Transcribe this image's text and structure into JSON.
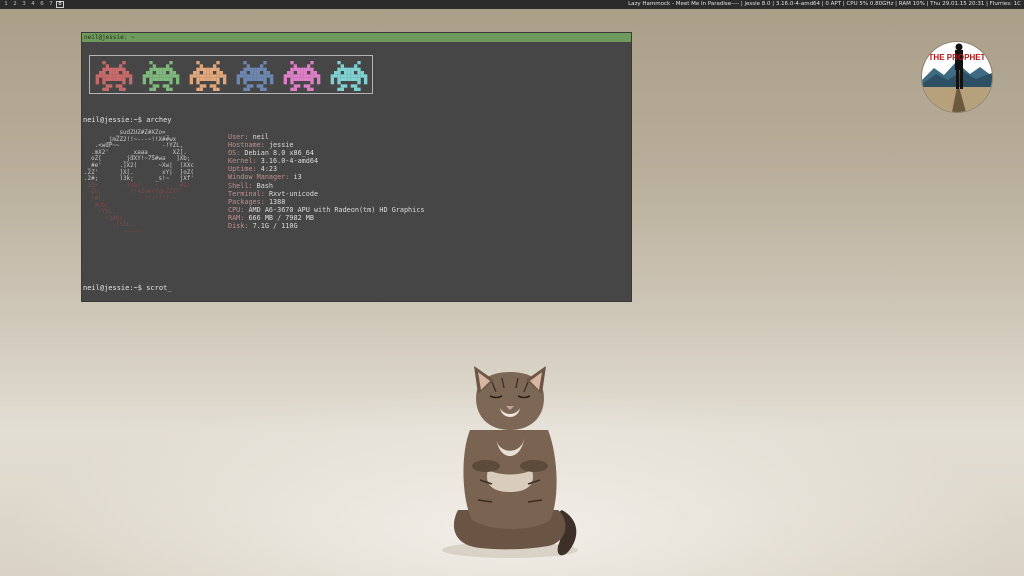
{
  "topbar": {
    "workspaces": [
      "1",
      "2",
      "3",
      "4",
      "6",
      "7",
      "8"
    ],
    "active_workspace": "8",
    "status": "Lazy Hammock - Meet Me In Paradise---- | jessie 8.0 | 3.16.0-4-amd64 | 0 APT | CPU 5% 0.80GHz | RAM 10% | Thu 29.01.15 20:31 | Flurries: 1C"
  },
  "terminal": {
    "title": "neil@jessie: ~",
    "prompt1": "neil@jessie:~$ archey",
    "prompt2": "neil@jessie:~$ scrot_",
    "invader_colors": [
      "#c86a6a",
      "#7fb97d",
      "#e2a77a",
      "#6d88b0",
      "#e07fc9",
      "#7fd2d2"
    ],
    "info": [
      {
        "key": "User:",
        "value": "neil"
      },
      {
        "key": "Hostname:",
        "value": "jessie"
      },
      {
        "key": "OS:",
        "value": "Debian 8.0 x86_64"
      },
      {
        "key": "Kernel:",
        "value": "3.16.0-4-amd64"
      },
      {
        "key": "Uptime:",
        "value": "4:23"
      },
      {
        "key": "Window Manager:",
        "value": "i3"
      },
      {
        "key": "Shell:",
        "value": "Bash"
      },
      {
        "key": "Terminal:",
        "value": "Rxvt-unicode"
      },
      {
        "key": "Packages:",
        "value": "1388"
      },
      {
        "key": "CPU:",
        "value": "AMD A6-3670 APU with Radeon(tm) HD Graphics"
      },
      {
        "key": "RAM:",
        "value": "666 MB / 7982 MB"
      },
      {
        "key": "Disk:",
        "value": "7.1G / 110G"
      }
    ]
  },
  "logo": {
    "text": "THE PROPHET"
  },
  "colors": {
    "terminal_bg": "#464646",
    "titlebar_green": "#6f9a5e",
    "info_key": "#c58d8d"
  }
}
